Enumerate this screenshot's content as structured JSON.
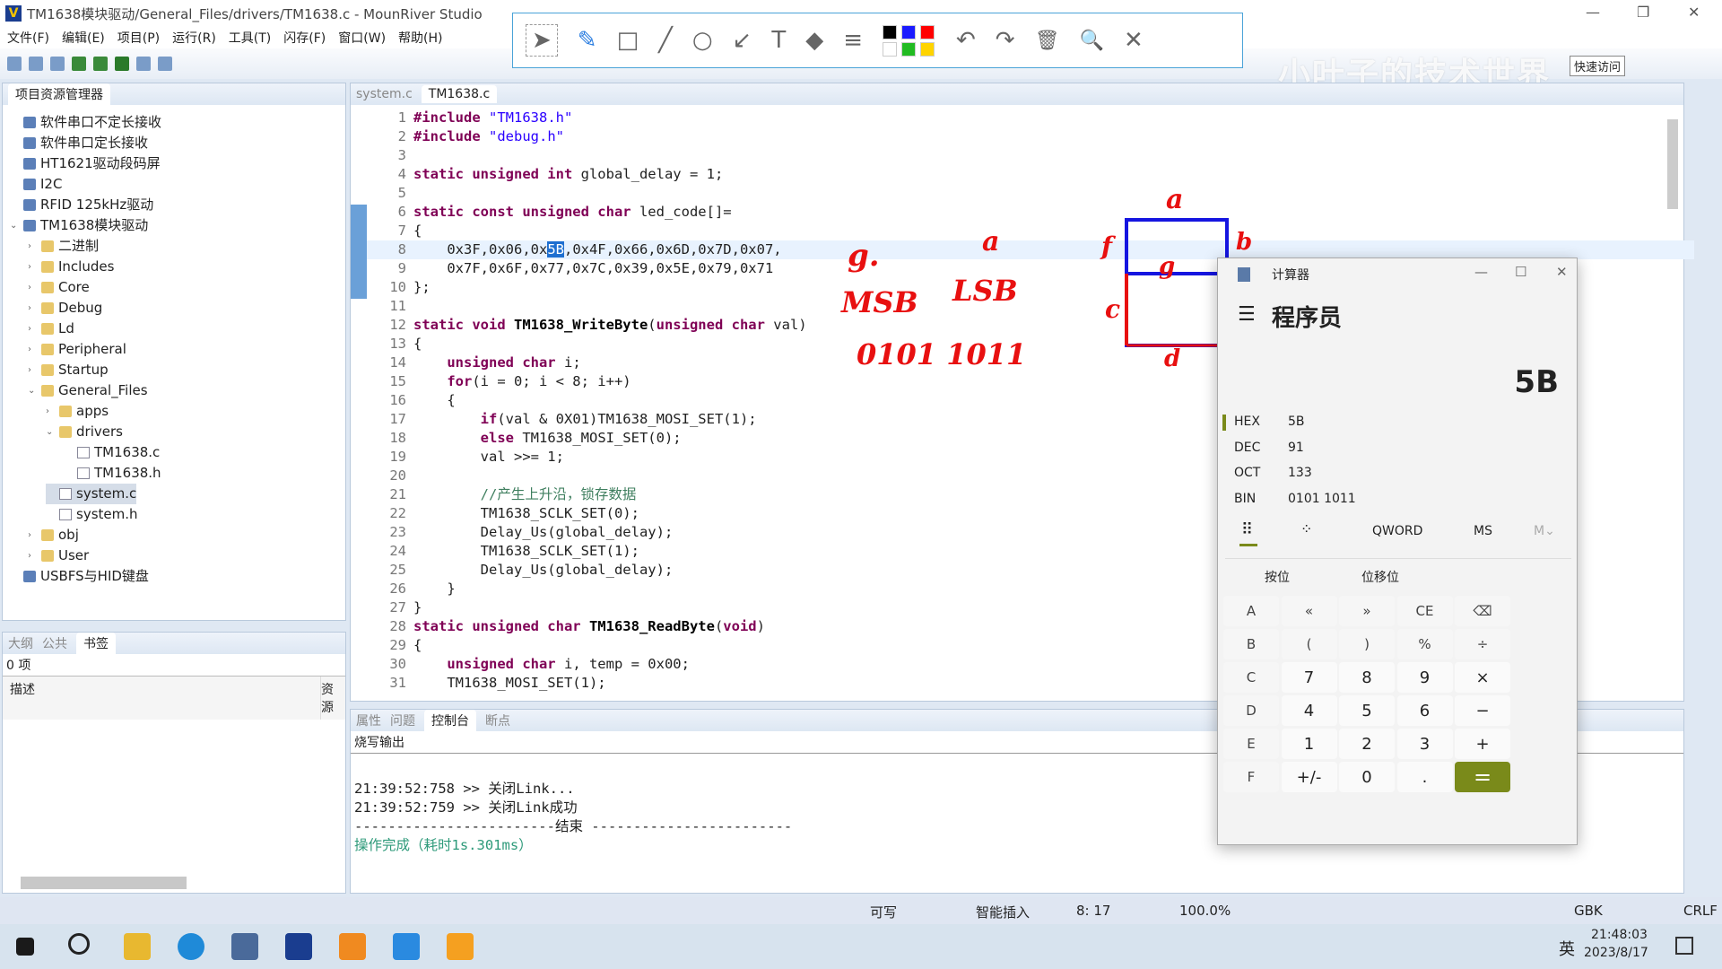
{
  "window": {
    "title": "TM1638模块驱动/General_Files/drivers/TM1638.c - MounRiver Studio",
    "minimize": "—",
    "restore": "❐",
    "close": "✕"
  },
  "menu": [
    "文件(F)",
    "编辑(E)",
    "项目(P)",
    "运行(R)",
    "工具(T)",
    "闪存(F)",
    "窗口(W)",
    "帮助(H)"
  ],
  "watermark": "小叶子的技术世界",
  "quick_access": "快速访问",
  "annotation_toolbar": {
    "tools": [
      "select-arrow",
      "pen",
      "rectangle",
      "line",
      "circle",
      "arrow",
      "text",
      "eraser",
      "line-width",
      "undo",
      "redo",
      "delete",
      "zoom",
      "close"
    ],
    "glyphs": [
      "➤",
      "✎",
      "□",
      "╱",
      "○",
      "↙",
      "T",
      "◆",
      "≡",
      "↶",
      "↷",
      "🗑",
      "🔍",
      "✕"
    ],
    "colors": [
      "#000000",
      "#1a1aff",
      "#ff0000",
      "#ffffff",
      "#22bb22",
      "#ffd400"
    ]
  },
  "explorer": {
    "title": "项目资源管理器",
    "items": [
      {
        "label": "软件串口不定长接收",
        "level": 0,
        "type": "proj",
        "tw": ""
      },
      {
        "label": "软件串口定长接收",
        "level": 0,
        "type": "proj",
        "tw": ""
      },
      {
        "label": "HT1621驱动段码屏",
        "level": 0,
        "type": "proj",
        "tw": ""
      },
      {
        "label": "I2C",
        "level": 0,
        "type": "proj",
        "tw": ""
      },
      {
        "label": "RFID 125kHz驱动",
        "level": 0,
        "type": "proj",
        "tw": ""
      },
      {
        "label": "TM1638模块驱动",
        "level": 0,
        "type": "proj",
        "tw": "⌄"
      },
      {
        "label": "二进制",
        "level": 1,
        "type": "fold",
        "tw": "›"
      },
      {
        "label": "Includes",
        "level": 1,
        "type": "fold",
        "tw": "›"
      },
      {
        "label": "Core",
        "level": 1,
        "type": "fold",
        "tw": "›"
      },
      {
        "label": "Debug",
        "level": 1,
        "type": "fold",
        "tw": "›"
      },
      {
        "label": "Ld",
        "level": 1,
        "type": "fold",
        "tw": "›"
      },
      {
        "label": "Peripheral",
        "level": 1,
        "type": "fold",
        "tw": "›"
      },
      {
        "label": "Startup",
        "level": 1,
        "type": "fold",
        "tw": "›"
      },
      {
        "label": "General_Files",
        "level": 1,
        "type": "fold",
        "tw": "⌄"
      },
      {
        "label": "apps",
        "level": 2,
        "type": "fold",
        "tw": "›"
      },
      {
        "label": "drivers",
        "level": 2,
        "type": "fold",
        "tw": "⌄"
      },
      {
        "label": "TM1638.c",
        "level": 3,
        "type": "file",
        "tw": ""
      },
      {
        "label": "TM1638.h",
        "level": 3,
        "type": "file",
        "tw": ""
      },
      {
        "label": "system.c",
        "level": 2,
        "type": "file",
        "tw": "",
        "selected": true
      },
      {
        "label": "system.h",
        "level": 2,
        "type": "file",
        "tw": ""
      },
      {
        "label": "obj",
        "level": 1,
        "type": "fold",
        "tw": "›"
      },
      {
        "label": "User",
        "level": 1,
        "type": "fold",
        "tw": "›"
      },
      {
        "label": "USBFS与HID键盘",
        "level": 0,
        "type": "proj",
        "tw": ""
      }
    ]
  },
  "bookmarks": {
    "tabs": [
      "大纲",
      "公共",
      "书签"
    ],
    "count": "0 项",
    "col_desc": "描述",
    "col_res": "资源"
  },
  "editor": {
    "tabs": [
      "system.c",
      "TM1638.c"
    ],
    "active_tab": 1,
    "lines": [
      [
        [
          "kw",
          "#include "
        ],
        [
          "str",
          "\"TM1638.h\""
        ]
      ],
      [
        [
          "kw",
          "#include "
        ],
        [
          "str",
          "\"debug.h\""
        ]
      ],
      [],
      [
        [
          "kw",
          "static unsigned int "
        ],
        [
          "t",
          "global_delay = 1;"
        ]
      ],
      [],
      [
        [
          "kw",
          "static const unsigned char "
        ],
        [
          "t",
          "led_code[]="
        ]
      ],
      [
        [
          "t",
          "{"
        ]
      ],
      [
        [
          "t",
          "    0x3F,0x06,0x"
        ],
        [
          "hl",
          "5B"
        ],
        [
          "t",
          ",0x4F,0x66,0x6D,0x7D,0x07,"
        ]
      ],
      [
        [
          "t",
          "    0x7F,0x6F,0x77,0x7C,0x39,0x5E,0x79,0x71"
        ]
      ],
      [
        [
          "t",
          "};"
        ]
      ],
      [],
      [
        [
          "kw",
          "static void "
        ],
        [
          "fn",
          "TM1638_WriteByte"
        ],
        [
          "t",
          "("
        ],
        [
          "kw",
          "unsigned char "
        ],
        [
          "t",
          "val)"
        ]
      ],
      [
        [
          "t",
          "{"
        ]
      ],
      [
        [
          "t",
          "    "
        ],
        [
          "kw",
          "unsigned char "
        ],
        [
          "t",
          "i;"
        ]
      ],
      [
        [
          "t",
          "    "
        ],
        [
          "kw",
          "for"
        ],
        [
          "t",
          "(i = 0; i < 8; i++)"
        ]
      ],
      [
        [
          "t",
          "    {"
        ]
      ],
      [
        [
          "t",
          "        "
        ],
        [
          "kw",
          "if"
        ],
        [
          "t",
          "(val & 0X01)TM1638_MOSI_SET(1);"
        ]
      ],
      [
        [
          "t",
          "        "
        ],
        [
          "kw",
          "else "
        ],
        [
          "t",
          "TM1638_MOSI_SET(0);"
        ]
      ],
      [
        [
          "t",
          "        val >>= 1;"
        ]
      ],
      [],
      [
        [
          "t",
          "        "
        ],
        [
          "cm",
          "//产生上升沿，锁存数据"
        ]
      ],
      [
        [
          "t",
          "        TM1638_SCLK_SET(0);"
        ]
      ],
      [
        [
          "t",
          "        Delay_Us(global_delay);"
        ]
      ],
      [
        [
          "t",
          "        TM1638_SCLK_SET(1);"
        ]
      ],
      [
        [
          "t",
          "        Delay_Us(global_delay);"
        ]
      ],
      [
        [
          "t",
          "    }"
        ]
      ],
      [
        [
          "t",
          "}"
        ]
      ],
      [
        [
          "kw",
          "static unsigned char "
        ],
        [
          "fn",
          "TM1638_ReadByte"
        ],
        [
          "t",
          "("
        ],
        [
          "kw",
          "void"
        ],
        [
          "t",
          ")"
        ]
      ],
      [
        [
          "t",
          "{"
        ]
      ],
      [
        [
          "t",
          "    "
        ],
        [
          "kw",
          "unsigned char "
        ],
        [
          "t",
          "i, temp = 0x00;"
        ]
      ],
      [
        [
          "t",
          "    TM1638_MOSI_SET(1);"
        ]
      ]
    ]
  },
  "console": {
    "tabs": [
      "属性",
      "问题",
      "控制台",
      "断点"
    ],
    "header": "烧写输出",
    "lines": [
      "21:39:52:758 >> 关闭Link...",
      "21:39:52:759 >> 关闭Link成功",
      "------------------------结束 ------------------------"
    ],
    "done": "操作完成（耗时1s.301ms）"
  },
  "status": {
    "writable": "可写",
    "insert": "智能插入",
    "position": "8: 17",
    "zoom": "100.0%",
    "encoding": "GBK",
    "eol": "CRLF"
  },
  "taskbar": {
    "time": "21:48:03",
    "date": "2023/8/17",
    "ime": "英"
  },
  "annotations": {
    "g_dot": "g.",
    "a": "a",
    "msb": "MSB",
    "lsb": "LSB",
    "bits": "0101 1011",
    "seg_a": "a",
    "seg_b": "b",
    "seg_c": "c",
    "seg_d": "d",
    "seg_f": "f",
    "seg_g": "g"
  },
  "calculator": {
    "title": "计算器",
    "mode": "程序员",
    "display": "5B",
    "rows": [
      {
        "k": "HEX",
        "v": "5B",
        "active": true
      },
      {
        "k": "DEC",
        "v": "91"
      },
      {
        "k": "OCT",
        "v": "133"
      },
      {
        "k": "BIN",
        "v": "0101 1011"
      }
    ],
    "word": "QWORD",
    "ms": "MS",
    "mv": "M⌄",
    "bitwise": "按位",
    "shift": "位移位",
    "keys": [
      [
        "A",
        "«",
        "»",
        "CE",
        "⌫"
      ],
      [
        "B",
        "(",
        ")",
        "%",
        "÷"
      ],
      [
        "C",
        "7",
        "8",
        "9",
        "×"
      ],
      [
        "D",
        "4",
        "5",
        "6",
        "−"
      ],
      [
        "E",
        "1",
        "2",
        "3",
        "+"
      ],
      [
        "F",
        "+/-",
        "0",
        ".",
        "="
      ]
    ],
    "accent": "#7a8a1a"
  }
}
